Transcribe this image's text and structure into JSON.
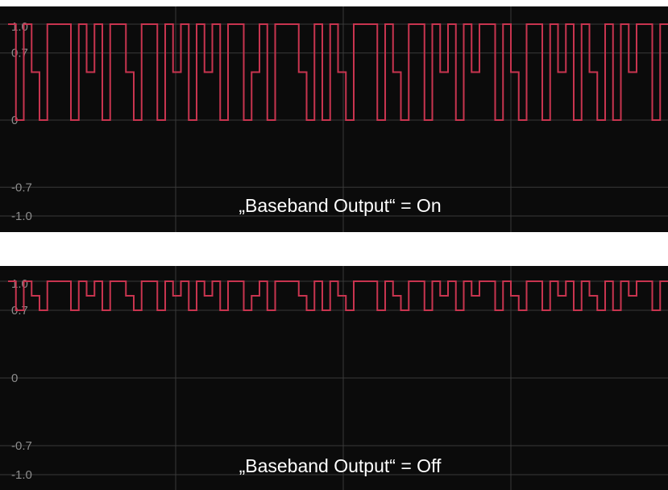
{
  "colors": {
    "background": "#0b0b0b",
    "grid": "#3a3a3a",
    "trace": "#c8344f",
    "tick_text": "#8c8c8c",
    "caption": "#ffffff"
  },
  "chart_data": [
    {
      "type": "line",
      "caption": "„Baseband Output“ = On",
      "ylim": [
        -1.1,
        1.1
      ],
      "ytick_labels": [
        "1.0",
        "0.7",
        "0",
        "-0.7",
        "-1.0"
      ],
      "ytick_values": [
        1.0,
        0.7,
        0,
        -0.7,
        -1.0
      ],
      "grid": true,
      "signal": {
        "high": 1.0,
        "low": 0.0,
        "mid": 0.5
      },
      "symbols": [
        2,
        0,
        2,
        1,
        0,
        2,
        2,
        2,
        0,
        2,
        1,
        2,
        0,
        2,
        2,
        1,
        0,
        2,
        2,
        0,
        2,
        1,
        2,
        0,
        2,
        1,
        2,
        0,
        2,
        2,
        0,
        1,
        2,
        0,
        2,
        2,
        2,
        1,
        0,
        2,
        0,
        2,
        1,
        0,
        2,
        2,
        2,
        0,
        2,
        1,
        0,
        2,
        2,
        0,
        2,
        1,
        2,
        0,
        2,
        1,
        2,
        2,
        0,
        2,
        1,
        0,
        2,
        2,
        0,
        2,
        1,
        2,
        0,
        2,
        1,
        0,
        2,
        0,
        2,
        1,
        2,
        2,
        0,
        2
      ]
    },
    {
      "type": "line",
      "caption": "„Baseband Output“ = Off",
      "ylim": [
        -1.1,
        1.1
      ],
      "ytick_labels": [
        "1.0",
        "0.7",
        "0",
        "-0.7",
        "-1.0"
      ],
      "ytick_values": [
        1.0,
        0.7,
        0,
        -0.7,
        -1.0
      ],
      "grid": true,
      "signal": {
        "high": 1.0,
        "low": 0.7,
        "mid": 0.85
      },
      "symbols": [
        2,
        0,
        2,
        1,
        0,
        2,
        2,
        2,
        0,
        2,
        1,
        2,
        0,
        2,
        2,
        1,
        0,
        2,
        2,
        0,
        2,
        1,
        2,
        0,
        2,
        1,
        2,
        0,
        2,
        2,
        0,
        1,
        2,
        0,
        2,
        2,
        2,
        1,
        0,
        2,
        0,
        2,
        1,
        0,
        2,
        2,
        2,
        0,
        2,
        1,
        0,
        2,
        2,
        0,
        2,
        1,
        2,
        0,
        2,
        1,
        2,
        2,
        0,
        2,
        1,
        0,
        2,
        2,
        0,
        2,
        1,
        2,
        0,
        2,
        1,
        0,
        2,
        0,
        2,
        1,
        2,
        2,
        0,
        2
      ]
    }
  ]
}
